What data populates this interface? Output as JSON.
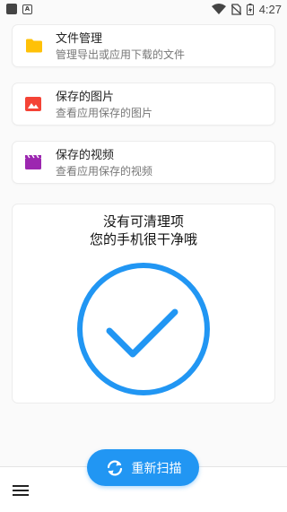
{
  "status_bar": {
    "time": "4:27",
    "icons": [
      "app-icon",
      "a-notification-icon",
      "wifi-icon",
      "no-sim-icon",
      "battery-charging-icon"
    ],
    "a_glyph": "A"
  },
  "cards": [
    {
      "title": "文件管理",
      "subtitle": "管理导出或应用下载的文件",
      "icon": "folder-icon",
      "color": "#FFC107"
    },
    {
      "title": "保存的图片",
      "subtitle": "查看应用保存的图片",
      "icon": "image-icon",
      "color": "#F44336"
    },
    {
      "title": "保存的视频",
      "subtitle": "查看应用保存的视频",
      "icon": "movie-icon",
      "color": "#9C27B0"
    }
  ],
  "status_card": {
    "line1": "没有可清理项",
    "line2": "您的手机很干净哦",
    "icon": "check-circle-icon",
    "color": "#2196F3"
  },
  "rescan_button": {
    "label": "重新扫描",
    "icon": "refresh-icon"
  },
  "bottom_bar": {
    "menu_icon": "menu-icon"
  }
}
